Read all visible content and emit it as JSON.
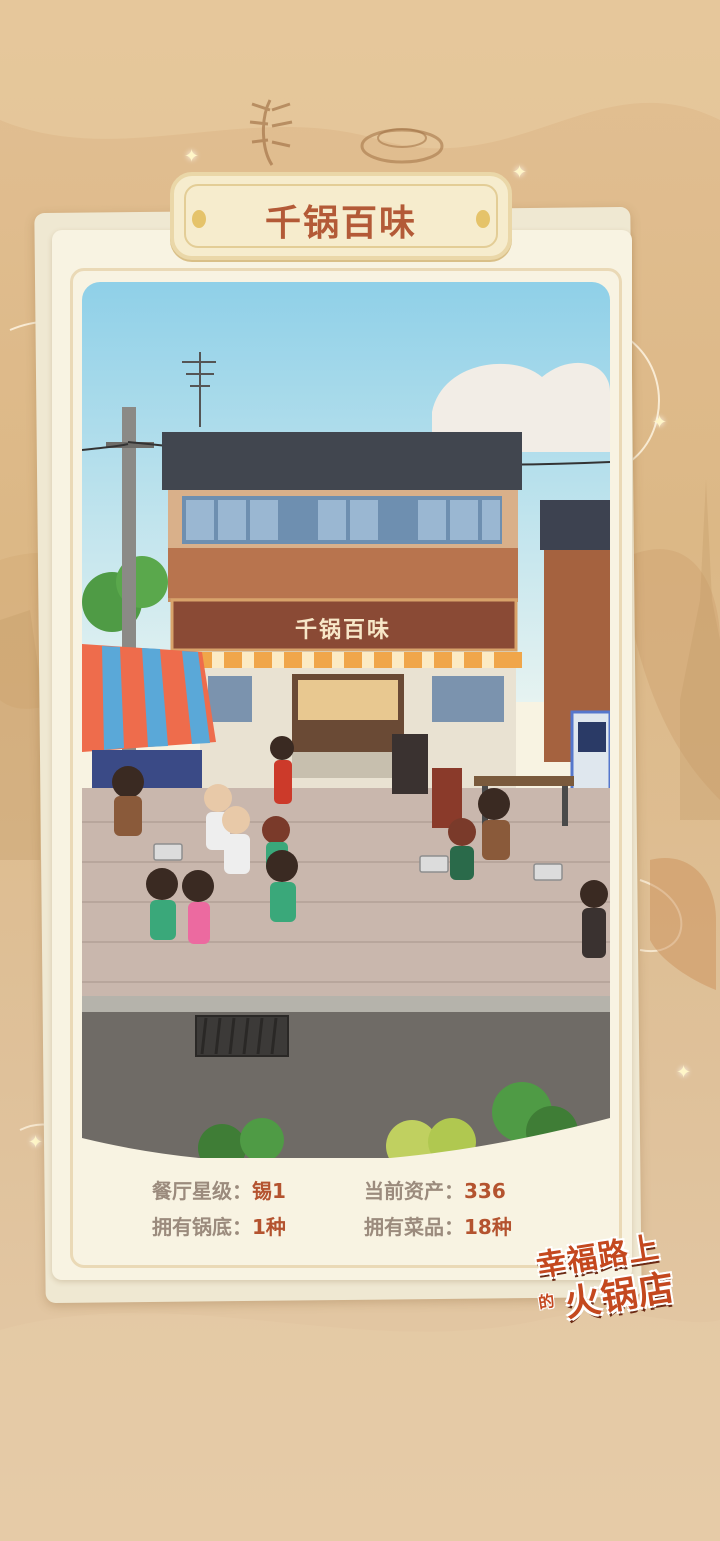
{
  "restaurant": {
    "name": "千锅百味",
    "sign_text": "千锅百味"
  },
  "stats": {
    "star_level": {
      "label": "餐厅星级：",
      "value": "锡1"
    },
    "current_assets": {
      "label": "当前资产：",
      "value": "336"
    },
    "soup_bases": {
      "label": "拥有锅底：",
      "value": "1种"
    },
    "dishes": {
      "label": "拥有菜品：",
      "value": "18种"
    }
  },
  "logo": {
    "line1": "幸福路上",
    "small": "的",
    "line2": "火锅店"
  },
  "colors": {
    "background": "#dcb886",
    "card": "#f8f3e2",
    "title_text": "#b35a37",
    "stat_label": "#9b8b7d",
    "stat_value": "#b4532f",
    "logo_red": "#c4481f"
  }
}
